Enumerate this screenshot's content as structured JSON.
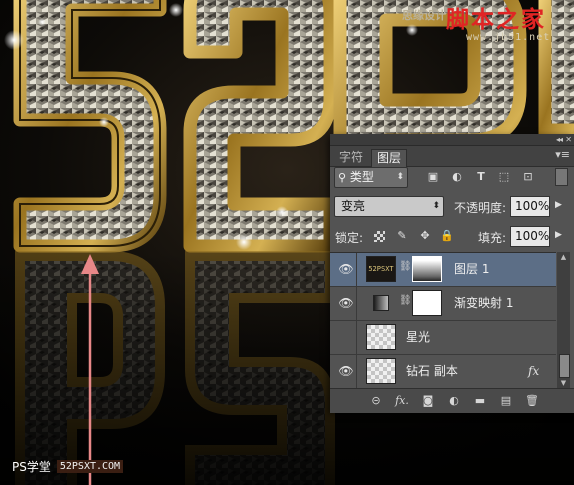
{
  "watermark": {
    "site_label": "思缘设计",
    "brand": "脚本之家",
    "url": "www.jb51.net"
  },
  "badge": {
    "label": "PS学堂",
    "url": "52PSXT.COM"
  },
  "artwork": {
    "glyphs": "52PO",
    "fill_color": "#8e8a80",
    "rim_color": "#c9a23a"
  },
  "layers_panel": {
    "topbar": {
      "collapse_icon": "double-chevron-icon",
      "close_icon": "close-icon"
    },
    "tabs": [
      {
        "label": "字符",
        "active": false
      },
      {
        "label": "图层",
        "active": true
      }
    ],
    "menu_icon": "panel-menu-icon",
    "filter": {
      "search_icon": "search-icon",
      "kind_label": "类型",
      "icons": [
        "pixel-filter-icon",
        "adjustment-filter-icon",
        "type-filter-icon",
        "shape-filter-icon",
        "smart-object-filter-icon"
      ],
      "symbols": {
        "pixel": "▣",
        "adjust": "◐",
        "type": "T",
        "shape": "⬚",
        "smart": "⊡"
      }
    },
    "blend_mode": "变亮",
    "opacity_label": "不透明度:",
    "opacity_value": "100%",
    "lock_label": "锁定:",
    "lock_icons": [
      "lock-transparent-icon",
      "lock-paint-icon",
      "lock-move-icon",
      "lock-all-icon"
    ],
    "lock_symbols": {
      "paint": "✎",
      "move": "✥",
      "all": "🔒"
    },
    "fill_label": "填充:",
    "fill_value": "100%",
    "layers": [
      {
        "name": "图层 1",
        "selected": true,
        "visible": true,
        "thumb": "type-art",
        "thumb_text": "52PSXT",
        "mask": "gradient",
        "fx": false
      },
      {
        "name": "渐变映射 1",
        "selected": false,
        "visible": true,
        "thumb": "gradient-map",
        "mask": "white",
        "fx": false
      },
      {
        "name": "星光",
        "selected": false,
        "visible": false,
        "thumb": "transparent",
        "mask": null,
        "fx": false
      },
      {
        "name": "钻石 副本",
        "selected": false,
        "visible": true,
        "thumb": "transparent",
        "mask": null,
        "fx": true,
        "fx_label": "fx"
      }
    ],
    "footer_icons": [
      "link-layers-icon",
      "fx-icon",
      "add-mask-icon",
      "adjustment-layer-icon",
      "new-group-icon",
      "new-layer-icon",
      "trash-icon"
    ],
    "footer_symbols": {
      "link": "⊝",
      "fx": "fx.",
      "mask": "◙",
      "adjust": "◐",
      "group": "▬",
      "new": "▤",
      "trash": "🗑"
    }
  },
  "colors": {
    "selected_row": "#5c6e86",
    "panel_bg": "#535353",
    "arrow": "#e88888"
  }
}
